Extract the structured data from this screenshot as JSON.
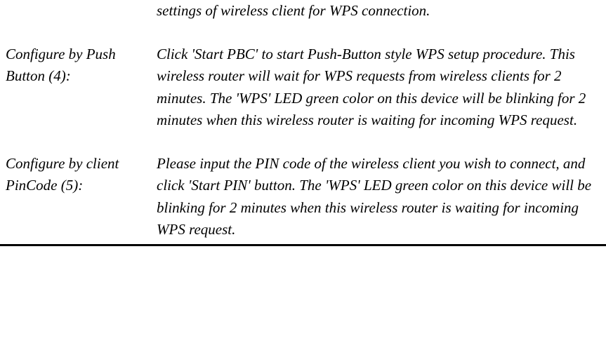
{
  "top_fragment": "settings of wireless client for WPS connection.",
  "items": [
    {
      "label": "Configure by Push Button (4):",
      "description": "Click 'Start PBC' to start Push-Button style WPS setup procedure. This wireless router will wait for WPS requests from wireless clients for 2 minutes. The 'WPS' LED green color on this device will be blinking for 2 minutes when this wireless router is waiting for incoming WPS request."
    },
    {
      "label": "Configure by client PinCode (5):",
      "description": "Please input the PIN code of the wireless client you wish to connect, and click 'Start PIN' button. The 'WPS' LED green color on this device will be blinking for 2 minutes when this wireless router is waiting for incoming WPS request."
    }
  ]
}
